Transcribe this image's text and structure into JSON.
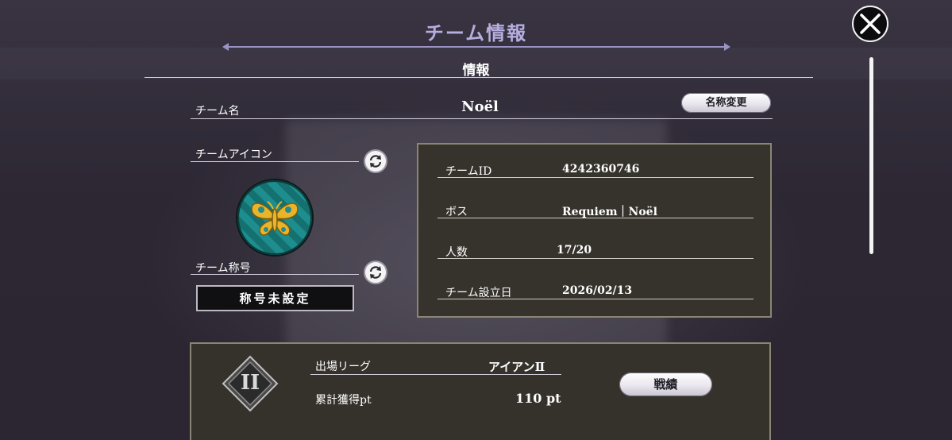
{
  "header": {
    "title": "チーム情報"
  },
  "section": {
    "heading": "情報"
  },
  "team": {
    "name_label": "チーム名",
    "name_value": "Noël",
    "rename_button": "名称変更",
    "icon_label": "チームアイコン",
    "title_label": "チーム称号",
    "title_value": "称号未設定"
  },
  "info": {
    "id_label": "チームID",
    "id_value": "4242360746",
    "boss_label": "ボス",
    "boss_value": "Requiem｜Noël",
    "members_label": "人数",
    "members_value": "17/20",
    "founded_label": "チーム設立日",
    "founded_value": "2026/02/13"
  },
  "league": {
    "badge": "II",
    "league_label": "出場リーグ",
    "league_value": "アイアンⅡ",
    "points_label": "累計獲得pt",
    "points_value": "110 pt",
    "record_button": "戦績"
  },
  "colors": {
    "accent": "#b7aee0",
    "panel": "#36332d",
    "panel_border": "#8a8575",
    "emblem": "#1d8d8d",
    "gold": "#e8b52a"
  },
  "icons": [
    "close-icon",
    "refresh-icon",
    "butterfly-emblem-icon",
    "league-rank-icon"
  ]
}
